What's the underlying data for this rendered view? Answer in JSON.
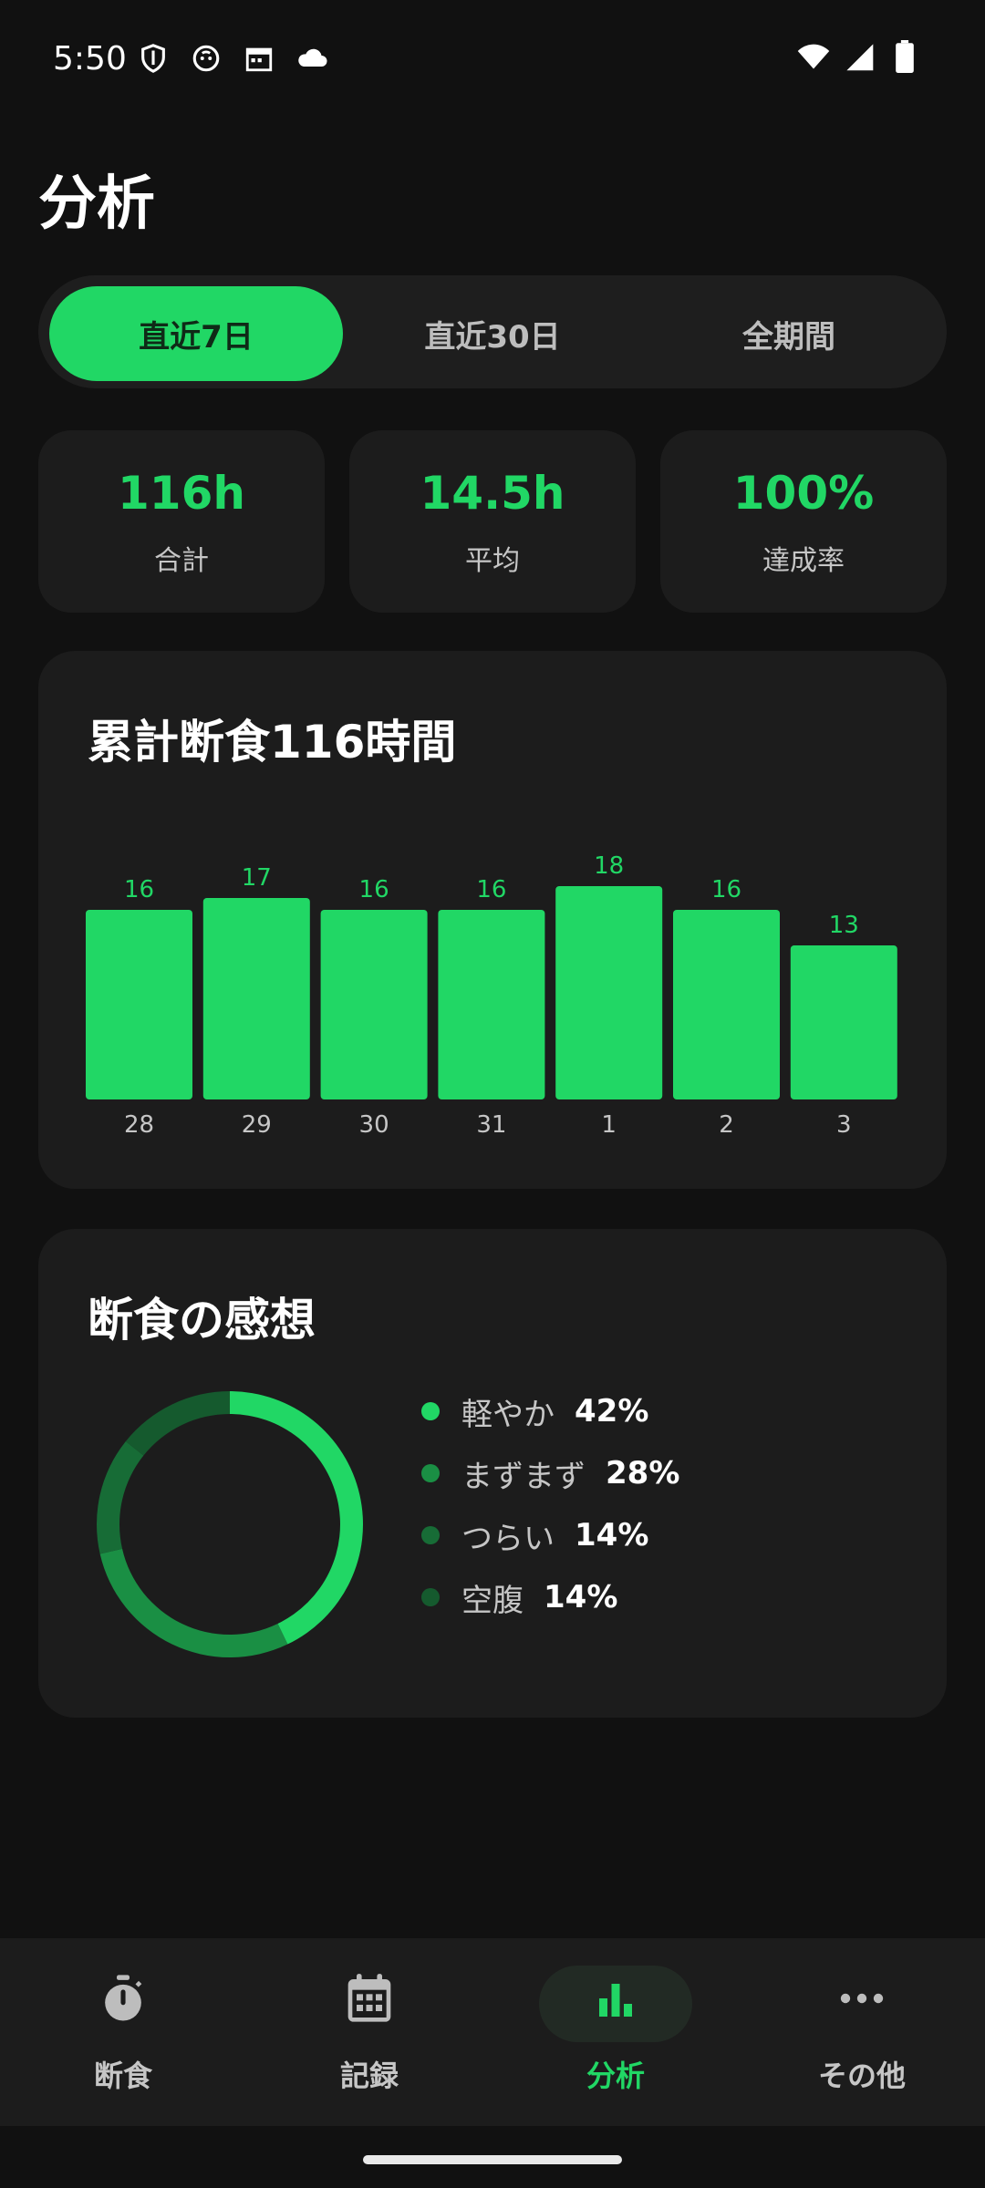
{
  "status_bar": {
    "time": "5:50",
    "left_icons": [
      "shield-icon",
      "cat-face-icon",
      "calendar-icon",
      "cloud-icon"
    ],
    "right_icons": [
      "wifi-icon",
      "signal-icon",
      "battery-icon"
    ]
  },
  "page": {
    "title": "分析"
  },
  "range_tabs": {
    "items": [
      {
        "label": "直近7日",
        "active": true
      },
      {
        "label": "直近30日",
        "active": false
      },
      {
        "label": "全期間",
        "active": false
      }
    ]
  },
  "stats": [
    {
      "value": "116h",
      "label": "合計"
    },
    {
      "value": "14.5h",
      "label": "平均"
    },
    {
      "value": "100%",
      "label": "達成率"
    }
  ],
  "chart_card": {
    "title": "累計断食116時間"
  },
  "chart_data": {
    "type": "bar",
    "title": "累計断食116時間",
    "categories": [
      "28",
      "29",
      "30",
      "31",
      "1",
      "2",
      "3"
    ],
    "values": [
      16,
      17,
      16,
      16,
      18,
      16,
      13
    ],
    "data_labels": true,
    "grid": false,
    "color": "#21d765"
  },
  "feelings": {
    "title": "断食の感想",
    "items": [
      {
        "label": "軽やか",
        "percent": "42%",
        "value": 42,
        "color": "#21d765"
      },
      {
        "label": "まずまず",
        "percent": "28%",
        "value": 28,
        "color": "#1a8f44"
      },
      {
        "label": "つらい",
        "percent": "14%",
        "value": 14,
        "color": "#176c36"
      },
      {
        "label": "空腹",
        "percent": "14%",
        "value": 14,
        "color": "#155a2e"
      }
    ]
  },
  "bottom_nav": {
    "items": [
      {
        "label": "断食",
        "icon": "stopwatch-icon",
        "active": false
      },
      {
        "label": "記録",
        "icon": "calendar-icon",
        "active": false
      },
      {
        "label": "分析",
        "icon": "bar-chart-icon",
        "active": true
      },
      {
        "label": "その他",
        "icon": "more-dots-icon",
        "active": false
      }
    ]
  },
  "colors": {
    "accent": "#21d765",
    "background": "#111111",
    "card": "#1c1c1c"
  }
}
